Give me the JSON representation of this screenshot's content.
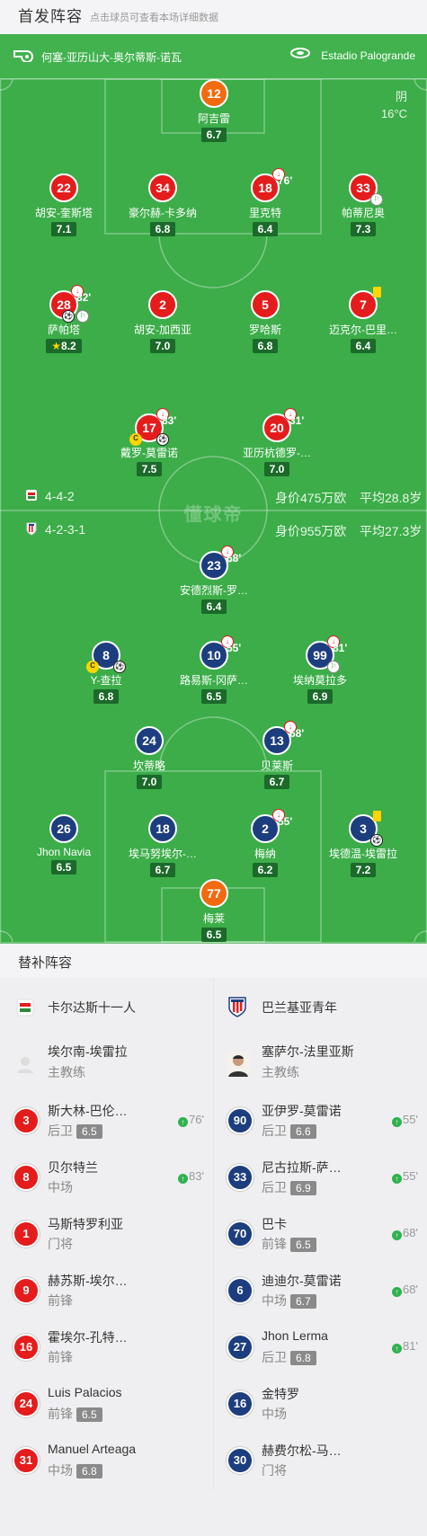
{
  "header": {
    "title": "首发阵容",
    "subtitle": "点击球员可查看本场详细数据"
  },
  "pitch": {
    "referee": "何塞-亚历山大-奥尔蒂斯-诺瓦",
    "stadium": "Estadio Palogrande",
    "weather": "阴",
    "temp": "16°C",
    "watermark": "懂球帝",
    "home_formation": "4-4-2",
    "home_value": "身价475万欧",
    "home_age": "平均28.8岁",
    "away_formation": "4-2-3-1",
    "away_value": "身价955万欧",
    "away_age": "平均27.3岁"
  },
  "home_players": [
    {
      "num": "12",
      "name": "阿吉雷",
      "rating": "6.7"
    },
    {
      "num": "22",
      "name": "胡安-奎斯塔",
      "rating": "7.1"
    },
    {
      "num": "34",
      "name": "豪尔赫-卡多纳",
      "rating": "6.8"
    },
    {
      "num": "18",
      "name": "里克特",
      "rating": "6.4",
      "sub": "76'"
    },
    {
      "num": "33",
      "name": "帕蒂尼奥",
      "rating": "7.3"
    },
    {
      "num": "28",
      "name": "萨帕塔",
      "rating": "8.2",
      "sub": "82'"
    },
    {
      "num": "2",
      "name": "胡安-加西亚",
      "rating": "7.0"
    },
    {
      "num": "5",
      "name": "罗哈斯",
      "rating": "6.8"
    },
    {
      "num": "7",
      "name": "迈克尔-巴里…",
      "rating": "6.4"
    },
    {
      "num": "17",
      "name": "戴罗-莫雷诺",
      "rating": "7.5",
      "sub": "83'"
    },
    {
      "num": "20",
      "name": "亚历杭德罗-…",
      "rating": "7.0",
      "sub": "31'"
    }
  ],
  "away_players": [
    {
      "num": "23",
      "name": "安德烈斯-罗…",
      "rating": "6.4",
      "sub": "68'"
    },
    {
      "num": "8",
      "name": "Y-查拉",
      "rating": "6.8"
    },
    {
      "num": "10",
      "name": "路易斯-冈萨…",
      "rating": "6.5",
      "sub": "55'"
    },
    {
      "num": "99",
      "name": "埃纳莫拉多",
      "rating": "6.9",
      "sub": "81'"
    },
    {
      "num": "24",
      "name": "坎蒂略",
      "rating": "7.0"
    },
    {
      "num": "13",
      "name": "贝莱斯",
      "rating": "6.7",
      "sub": "68'"
    },
    {
      "num": "26",
      "name": "Jhon Navia",
      "rating": "6.5"
    },
    {
      "num": "18",
      "name": "埃马努埃尔-…",
      "rating": "6.7"
    },
    {
      "num": "2",
      "name": "梅纳",
      "rating": "6.2",
      "sub": "55'"
    },
    {
      "num": "3",
      "name": "埃德温-埃雷拉",
      "rating": "7.2"
    },
    {
      "num": "77",
      "name": "梅莱",
      "rating": "6.5"
    }
  ],
  "bench": {
    "title": "替补阵容",
    "home_team": "卡尔达斯十一人",
    "away_team": "巴兰基亚青年",
    "home_coach": {
      "name": "埃尔南-埃雷拉",
      "role": "主教练"
    },
    "away_coach": {
      "name": "塞萨尔-法里亚斯",
      "role": "主教练"
    },
    "home": [
      {
        "num": "3",
        "name": "斯大林-巴伦…",
        "pos": "后卫",
        "rating": "6.5",
        "time": "76'"
      },
      {
        "num": "8",
        "name": "贝尔特兰",
        "pos": "中场",
        "time": "83'"
      },
      {
        "num": "1",
        "name": "马斯特罗利亚",
        "pos": "门将"
      },
      {
        "num": "9",
        "name": "赫苏斯-埃尔…",
        "pos": "前锋"
      },
      {
        "num": "16",
        "name": "霍埃尔-孔特…",
        "pos": "前锋"
      },
      {
        "num": "24",
        "name": "Luis Palacios",
        "pos": "前锋",
        "rating": "6.5"
      },
      {
        "num": "31",
        "name": "Manuel Arteaga",
        "pos": "中场",
        "rating": "6.8"
      }
    ],
    "away": [
      {
        "num": "90",
        "name": "亚伊罗-莫雷诺",
        "pos": "后卫",
        "rating": "6.6",
        "time": "55'"
      },
      {
        "num": "33",
        "name": "尼古拉斯-萨…",
        "pos": "后卫",
        "rating": "6.9",
        "time": "55'"
      },
      {
        "num": "70",
        "name": "巴卡",
        "pos": "前锋",
        "rating": "6.5",
        "time": "68'"
      },
      {
        "num": "6",
        "name": "迪迪尔-莫雷诺",
        "pos": "中场",
        "rating": "6.7",
        "time": "68'"
      },
      {
        "num": "27",
        "name": "Jhon Lerma",
        "pos": "后卫",
        "rating": "6.8",
        "time": "81'"
      },
      {
        "num": "16",
        "name": "金特罗",
        "pos": "中场"
      },
      {
        "num": "30",
        "name": "赫费尔松-马…",
        "pos": "门将"
      }
    ]
  },
  "colors": {
    "pitch": "#3cad49",
    "home": "#e51c1c",
    "away": "#1d3e7e",
    "gk": "#f26a0f"
  }
}
